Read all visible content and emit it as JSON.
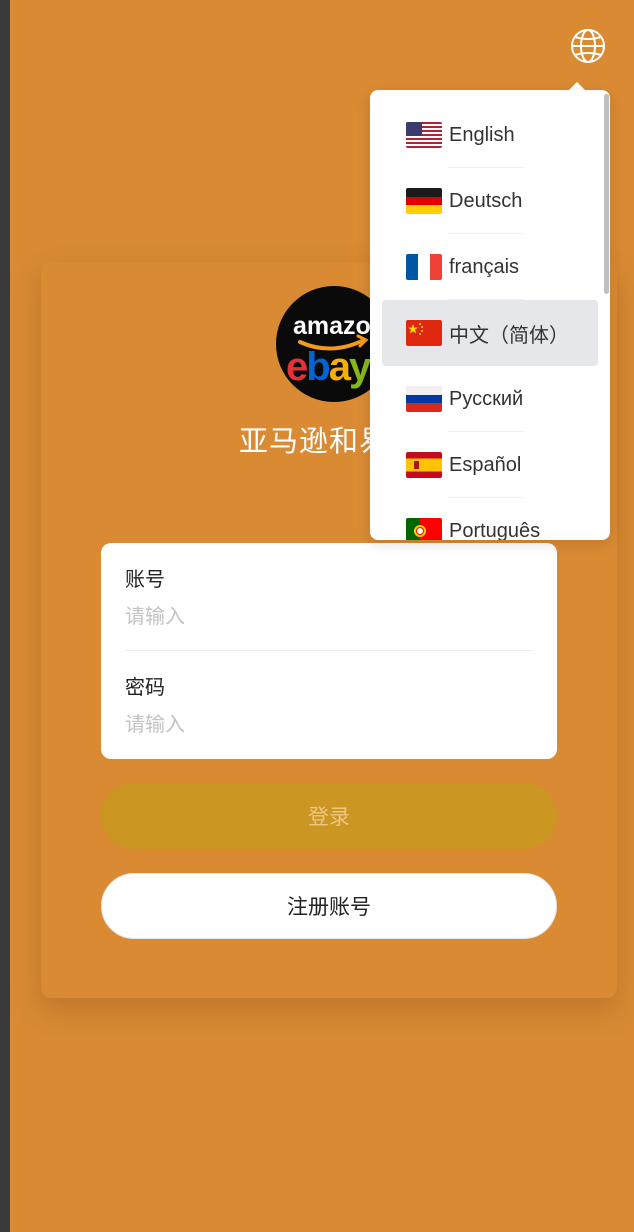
{
  "app": {
    "title": "亚马逊和易贝"
  },
  "header": {
    "language_icon": "globe-icon"
  },
  "form": {
    "account": {
      "label": "账号",
      "placeholder": "请输入"
    },
    "password": {
      "label": "密码",
      "placeholder": "请输入"
    }
  },
  "buttons": {
    "login": "登录",
    "register": "注册账号"
  },
  "language_menu": {
    "selected": "中文（简体）",
    "items": [
      {
        "label": "English",
        "flag": "us-flag"
      },
      {
        "label": "Deutsch",
        "flag": "de-flag"
      },
      {
        "label": "français",
        "flag": "fr-flag"
      },
      {
        "label": "中文（简体）",
        "flag": "cn-flag"
      },
      {
        "label": "Русский",
        "flag": "ru-flag"
      },
      {
        "label": "Español",
        "flag": "es-flag"
      },
      {
        "label": "Português",
        "flag": "pt-flag"
      }
    ]
  },
  "logo": {
    "text_top": "amazon",
    "text_bottom": "ebay"
  },
  "colors": {
    "background": "#d98a33",
    "login_button": "#cc9622",
    "login_text": "#ecc884",
    "active_language_bg": "#e6e7ea"
  }
}
